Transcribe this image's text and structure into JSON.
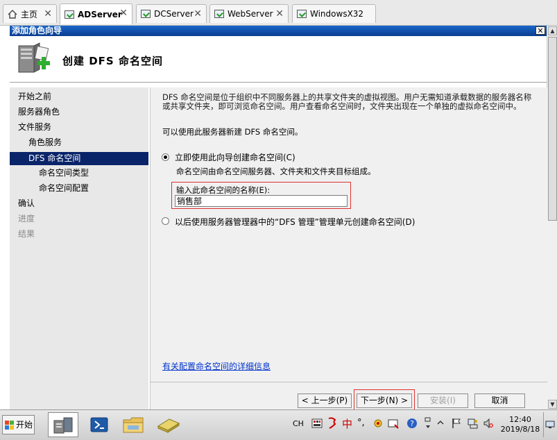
{
  "tabs": [
    {
      "label": "主页",
      "icon": "home-icon"
    },
    {
      "label": "ADServer",
      "icon": "vm-icon",
      "active": true
    },
    {
      "label": "DCServer",
      "icon": "vm-icon"
    },
    {
      "label": "WebServer",
      "icon": "vm-icon"
    },
    {
      "label": "WindowsX32",
      "icon": "vm-icon"
    }
  ],
  "dialog": {
    "title": "添加角色向导",
    "close_label": "✕",
    "header_title": "创建 DFS 命名空间"
  },
  "nav": {
    "items": [
      {
        "label": "开始之前",
        "level": 0,
        "state": "normal"
      },
      {
        "label": "服务器角色",
        "level": 0,
        "state": "normal"
      },
      {
        "label": "文件服务",
        "level": 0,
        "state": "normal"
      },
      {
        "label": "角色服务",
        "level": 1,
        "state": "normal"
      },
      {
        "label": "DFS 命名空间",
        "level": 1,
        "state": "selected"
      },
      {
        "label": "命名空间类型",
        "level": 2,
        "state": "normal"
      },
      {
        "label": "命名空间配置",
        "level": 2,
        "state": "normal"
      },
      {
        "label": "确认",
        "level": 0,
        "state": "normal"
      },
      {
        "label": "进度",
        "level": 0,
        "state": "disabled"
      },
      {
        "label": "结果",
        "level": 0,
        "state": "disabled"
      }
    ]
  },
  "content": {
    "description": "DFS 命名空间是位于组织中不同服务器上的共享文件夹的虚拟视图。用户无需知道承载数据的服务器名称或共享文件夹，即可浏览命名空间。用户查看命名空间时，文件夹出现在一个单独的虚拟命名空间中。",
    "can_create": "可以使用此服务器新建 DFS 命名空间。",
    "option_now": "立即使用此向导创建命名空间(C)",
    "option_now_sub": "命名空间由命名空间服务器、文件夹和文件夹目标组成。",
    "name_label": "输入此命名空间的名称(E):",
    "name_value": "销售部",
    "option_later": "以后使用服务器管理器中的“DFS 管理”管理单元创建命名空间(D)",
    "link": "有关配置命名空间的详细信息"
  },
  "buttons": {
    "prev": "< 上一步(P)",
    "next": "下一步(N) >",
    "install": "安装(I)",
    "cancel": "取消"
  },
  "taskbar": {
    "start_label": "开始",
    "lang": "CH",
    "ime_char": "中",
    "ime_dot": "°,",
    "time": "12:40",
    "date": "2019/8/18"
  }
}
